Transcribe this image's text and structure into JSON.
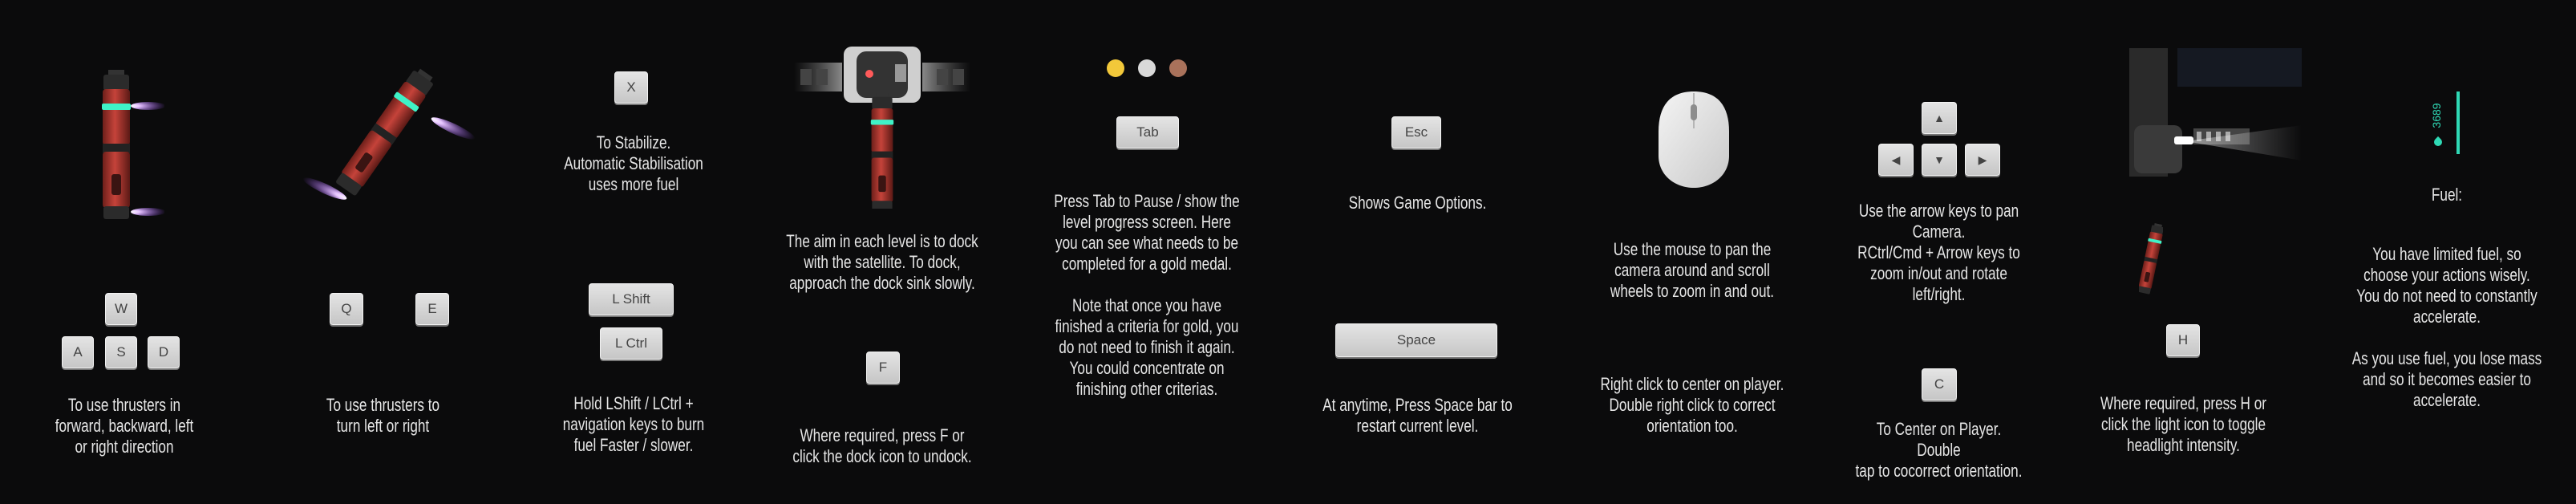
{
  "panels": {
    "wasd": {
      "keys": {
        "w": "W",
        "a": "A",
        "s": "S",
        "d": "D"
      },
      "text": "To use thrusters in\nforward, backward, left\nor right direction"
    },
    "qe": {
      "keys": {
        "q": "Q",
        "e": "E"
      },
      "text": "To use thrusters to\nturn left or right"
    },
    "stabilize": {
      "keys": {
        "x": "X",
        "lshift": "L Shift",
        "lctrl": "L Ctrl"
      },
      "text_top": "To Stabilize.\nAutomatic Stabilisation\nuses more fuel",
      "text_bottom": "Hold LShift / LCtrl +\nnavigation keys to burn\nfuel Faster / slower."
    },
    "dock": {
      "keys": {
        "f": "F"
      },
      "text_top": "The aim in each level is to dock\nwith the satellite. To dock,\napproach the dock sink slowly.",
      "text_bottom": "Where required, press F or\nclick the dock icon to undock."
    },
    "pause": {
      "keys": {
        "tab": "Tab"
      },
      "medal_colors": [
        "#f2c83a",
        "#d9d9d9",
        "#a9725b"
      ],
      "text": "Press Tab to Pause / show the\nlevel progress screen. Here\nyou can see what needs to be\ncompleted for a gold medal.\n\nNote that once you have\nfinished a criteria for gold, you\ndo not need to finish it again.\nYou could concentrate on\nfinishing other criterias."
    },
    "options": {
      "keys": {
        "esc": "Esc",
        "space": "Space"
      },
      "text_top": "Shows Game Options.",
      "text_bottom": "At anytime, Press Space bar to\nrestart current level."
    },
    "mouse": {
      "icon": "mouse-icon",
      "text_top": "Use the mouse to pan the\ncamera around and scroll\nwheels to zoom in and out.",
      "text_bottom": "Right click to center on player.\nDouble right click to correct\norientation too."
    },
    "camera": {
      "keys": {
        "up": "▲",
        "left": "◀",
        "down": "▼",
        "right": "▶",
        "c": "C"
      },
      "text_top": "Use the arrow keys to pan\nCamera.\nRCtrl/Cmd + Arrow keys to\nzoom in/out and rotate\nleft/right.",
      "text_bottom": "To Center on Player. Double\ntap to cocorrect orientation."
    },
    "headlight": {
      "keys": {
        "h": "H"
      },
      "text": "Where required, press H or\nclick the light icon to toggle\nheadlight intensity."
    },
    "fuel": {
      "gauge_value": "3689",
      "title": "Fuel:",
      "text": "You have limited fuel, so\nchoose your actions wisely.\nYou do not need to constantly\naccelerate.\n\nAs you use fuel, you lose mass\nand so it becomes easier to\naccelerate.",
      "accent": "#2fd9b5"
    }
  },
  "colors": {
    "background": "#0b0b0c",
    "ship_body": "#b0392f",
    "ship_glow": "#3ff2c7",
    "thrust": "#c79bff"
  }
}
